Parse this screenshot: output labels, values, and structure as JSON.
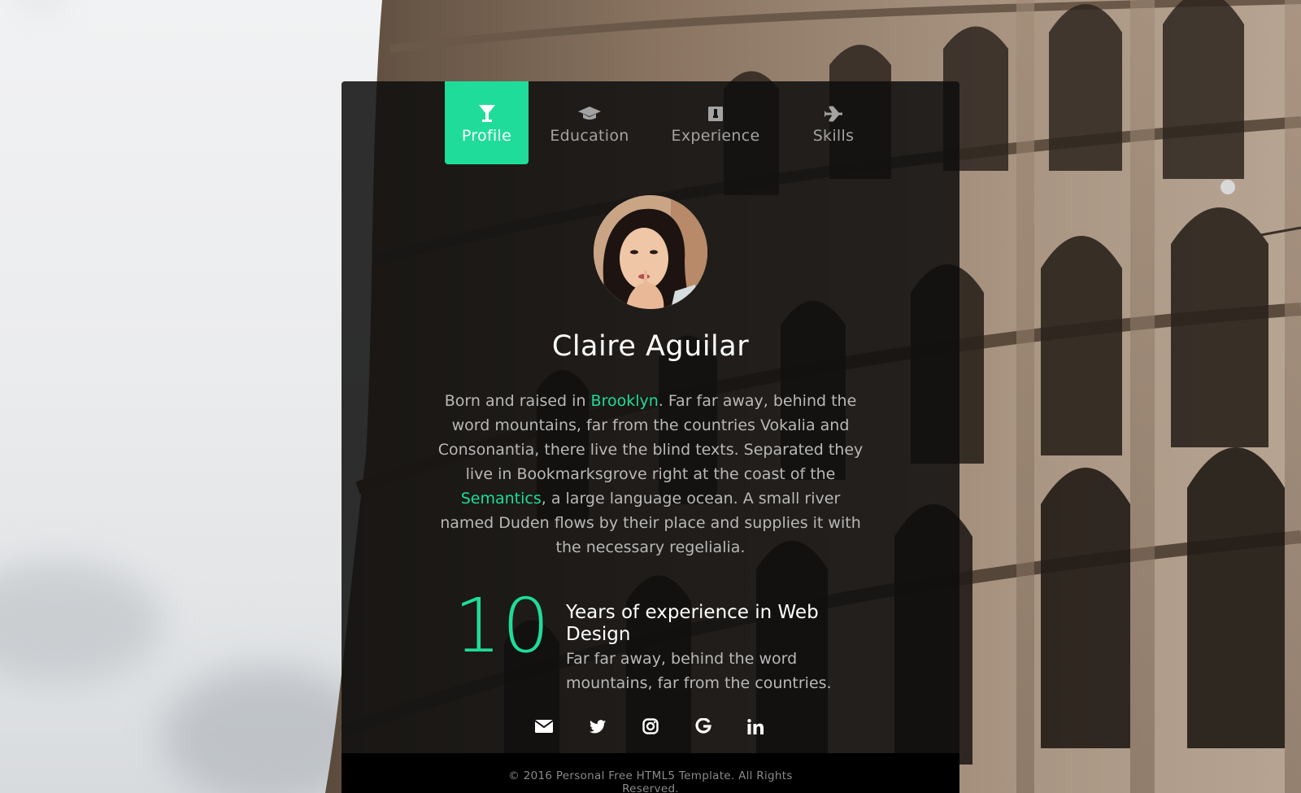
{
  "nav": {
    "tabs": [
      {
        "label": "Profile",
        "icon": "cocktail-glass-icon",
        "active": true
      },
      {
        "label": "Education",
        "icon": "graduation-cap-icon",
        "active": false
      },
      {
        "label": "Experience",
        "icon": "briefcase-icon",
        "active": false
      },
      {
        "label": "Skills",
        "icon": "airplane-icon",
        "active": false
      }
    ]
  },
  "profile": {
    "name": "Claire Aguilar",
    "bio": {
      "part1": "Born and raised in ",
      "link1": "Brooklyn",
      "part2": ". Far far away, behind the word mountains, far from the countries Vokalia and Consonantia, there live the blind texts. Separated they live in Bookmarksgrove right at the coast of the ",
      "link2": "Semantics",
      "part3": ", a large language ocean. A small river named Duden flows by their place and supplies it with the necessary regelialia."
    }
  },
  "experience": {
    "number": "10",
    "title": "Years of experience in Web Design",
    "description": "Far far away, behind the word mountains, far from the countries."
  },
  "social": [
    {
      "icon": "envelope-icon"
    },
    {
      "icon": "twitter-icon"
    },
    {
      "icon": "instagram-icon"
    },
    {
      "icon": "google-icon"
    },
    {
      "icon": "linkedin-icon"
    }
  ],
  "footer": {
    "copyright": "© 2016 Personal Free HTML5 Template. All Rights Reserved."
  },
  "colors": {
    "accent": "#1fdc9a",
    "card_bg": "rgba(14,14,14,0.86)",
    "text_muted": "#b8b8b8",
    "footer_bg": "#000000"
  }
}
